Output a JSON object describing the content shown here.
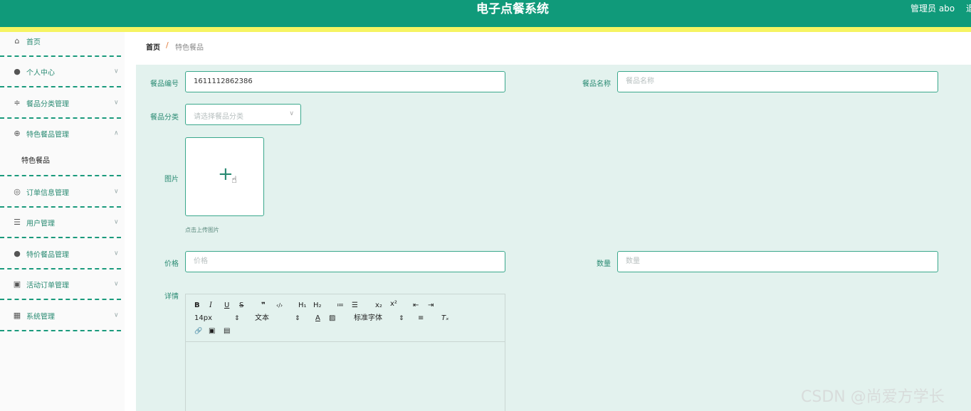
{
  "header": {
    "title": "电子点餐系统",
    "user_label": "管理员 abo",
    "logout_partial": "退"
  },
  "colors": {
    "header_bg": "#109a7a",
    "stripe": "#f6f462",
    "accent": "#2a8b73",
    "content_bg": "#e3f2ee"
  },
  "sidebar": {
    "items": [
      {
        "label": "首页",
        "icon": "home-icon"
      },
      {
        "label": "个人中心",
        "icon": "user-icon"
      },
      {
        "label": "餐品分类管理",
        "icon": "sliders-icon"
      },
      {
        "label": "特色餐品管理",
        "icon": "compass-icon"
      },
      {
        "label": "特色餐品",
        "icon": ""
      },
      {
        "label": "订单信息管理",
        "icon": "lifebuoy-icon"
      },
      {
        "label": "用户管理",
        "icon": "list-icon"
      },
      {
        "label": "特价餐品管理",
        "icon": "pin-icon"
      },
      {
        "label": "活动订单管理",
        "icon": "clipboard-icon"
      },
      {
        "label": "系统管理",
        "icon": "grid-icon"
      }
    ]
  },
  "breadcrumb": {
    "home": "首页",
    "separator": "/",
    "current": "特色餐品"
  },
  "form": {
    "code": {
      "label": "餐品编号",
      "value": "1611112862386"
    },
    "name": {
      "label": "餐品名称",
      "placeholder": "餐品名称"
    },
    "category": {
      "label": "餐品分类",
      "placeholder": "请选择餐品分类"
    },
    "image": {
      "label": "图片",
      "hint": "点击上传图片"
    },
    "price": {
      "label": "价格",
      "placeholder": "价格"
    },
    "quantity": {
      "label": "数量",
      "placeholder": "数量"
    },
    "detail": {
      "label": "详情"
    }
  },
  "editor": {
    "bold": "B",
    "italic": "I",
    "underline": "U",
    "strike": "S",
    "quote": "❞",
    "code": "‹/›",
    "h1": "H₁",
    "h2": "H₂",
    "ordered_list": "≔",
    "bullet_list": "☰",
    "subscript": "x₂",
    "superscript": "x²",
    "outdent": "⇤",
    "indent": "⇥",
    "size": "14px",
    "size_arrow": "⇕",
    "header_style": "文本",
    "header_arrow": "⇕",
    "font_color": "A",
    "background_color": "▨",
    "font_family": "标准字体",
    "font_arrow": "⇕",
    "align": "≡",
    "clean": "Tₓ",
    "link": "🔗",
    "image": "▣",
    "video": "▤"
  },
  "watermark": "CSDN @尚爱方学长"
}
